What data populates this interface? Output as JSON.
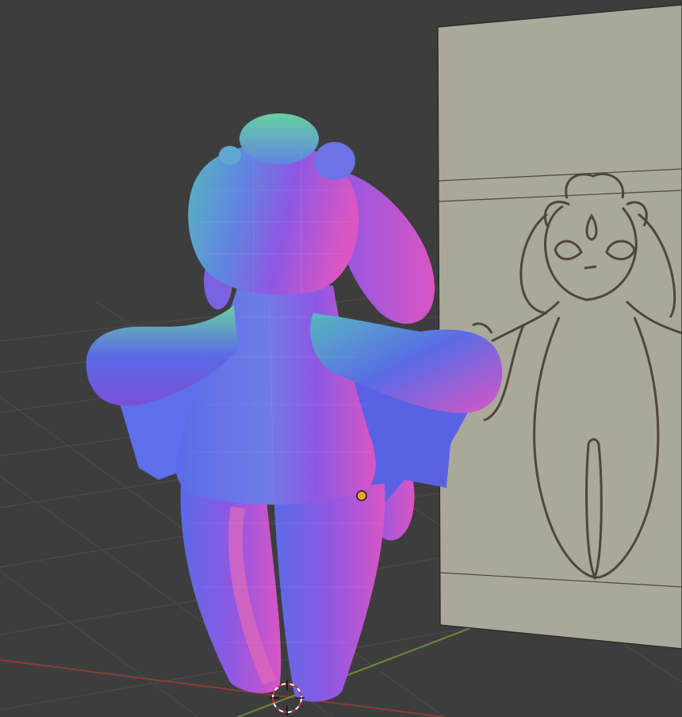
{
  "viewport": {
    "kind": "3d-viewport",
    "background_color": "#3d3d3d",
    "grid_color": "#4a4a4a",
    "x_axis_color": "#8a3a3a",
    "y_axis_color": "#6a8a3a"
  },
  "reference_image": {
    "kind": "sketch-reference-plane",
    "plane_color": "#a9a89a",
    "line_color": "#4f463c"
  },
  "model": {
    "kind": "sculpted-mesh",
    "shading": "normal-map",
    "colors": {
      "blue": "#5a6be6",
      "violet": "#8e58e3",
      "magenta": "#d955c4",
      "teal": "#56b7bf",
      "green": "#68d0a0"
    }
  },
  "origin_point": {
    "color": "#f0a030"
  },
  "cursor_3d": {
    "kind": "3d-cursor"
  }
}
